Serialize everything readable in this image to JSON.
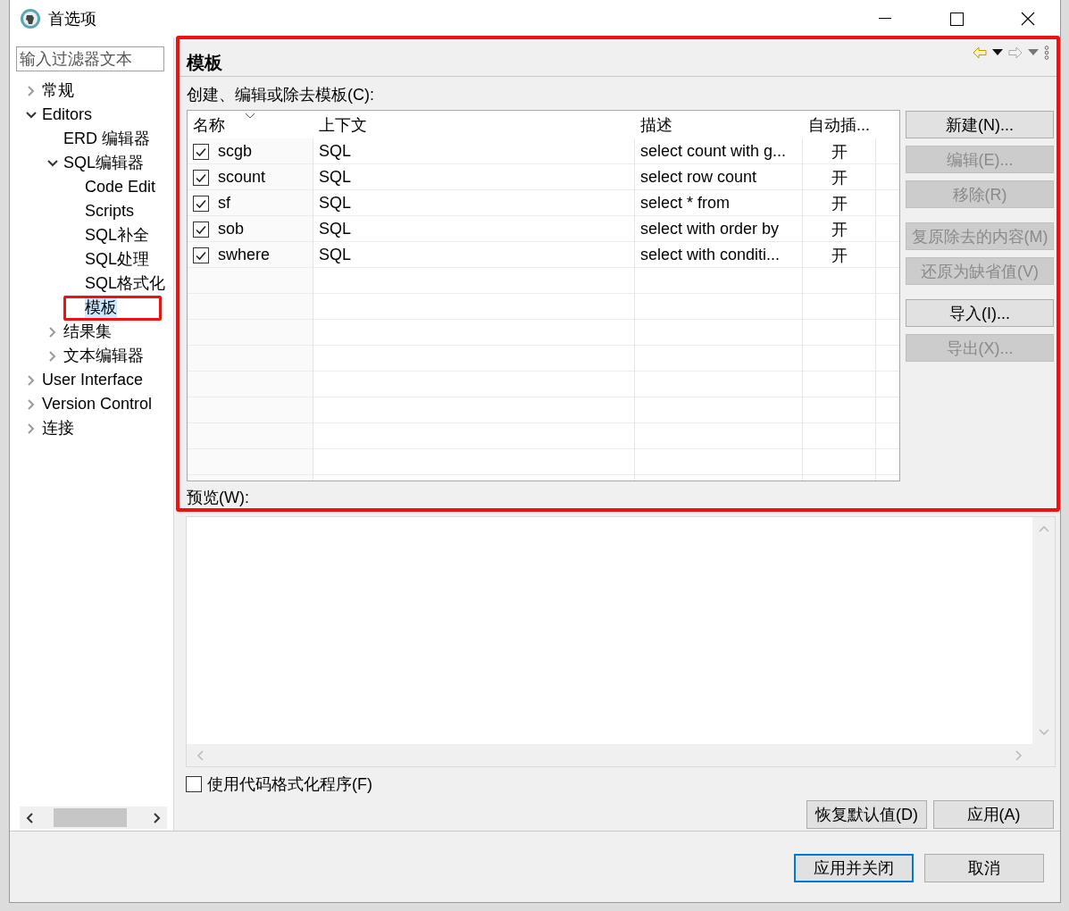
{
  "window": {
    "title": "首选项"
  },
  "filter": {
    "placeholder": "输入过滤器文本"
  },
  "tree": [
    {
      "label": "常规",
      "expanded": false,
      "selected": false
    },
    {
      "label": "Editors",
      "expanded": true,
      "selected": false,
      "children": [
        {
          "label": "ERD 编辑器",
          "selected": false
        },
        {
          "label": "SQL编辑器",
          "expanded": true,
          "selected": false,
          "children": [
            {
              "label": "Code Edit",
              "selected": false
            },
            {
              "label": "Scripts",
              "selected": false
            },
            {
              "label": "SQL补全",
              "selected": false
            },
            {
              "label": "SQL处理",
              "selected": false
            },
            {
              "label": "SQL格式化",
              "selected": false
            },
            {
              "label": "模板",
              "selected": true,
              "highlighted": true
            }
          ]
        },
        {
          "label": "结果集",
          "expanded": false,
          "selected": false
        },
        {
          "label": "文本编辑器",
          "expanded": false,
          "selected": false
        }
      ]
    },
    {
      "label": "User Interface",
      "expanded": false,
      "selected": false
    },
    {
      "label": "Version Control",
      "expanded": false,
      "selected": false
    },
    {
      "label": "连接",
      "expanded": false,
      "selected": false
    }
  ],
  "page": {
    "title": "模板",
    "highlighted": true,
    "nav": {
      "back_enabled": true,
      "forward_enabled": false
    },
    "table_label": "创建、编辑或除去模板(C):",
    "table": {
      "columns": [
        {
          "label": "名称",
          "sorted": true
        },
        {
          "label": "上下文",
          "sorted": false
        },
        {
          "label": "描述",
          "sorted": false
        },
        {
          "label": "自动插...",
          "sorted": false
        }
      ],
      "rows": [
        {
          "checked": true,
          "name": "scgb",
          "context": "SQL",
          "description": "select count with g...",
          "auto_insert": "开"
        },
        {
          "checked": true,
          "name": "scount",
          "context": "SQL",
          "description": "select row count",
          "auto_insert": "开"
        },
        {
          "checked": true,
          "name": "sf",
          "context": "SQL",
          "description": "select * from",
          "auto_insert": "开"
        },
        {
          "checked": true,
          "name": "sob",
          "context": "SQL",
          "description": "select with order by",
          "auto_insert": "开"
        },
        {
          "checked": true,
          "name": "swhere",
          "context": "SQL",
          "description": "select with conditi...",
          "auto_insert": "开"
        }
      ]
    },
    "button_groups": [
      [
        {
          "label": "新建(N)...",
          "disabled": false
        },
        {
          "label": "编辑(E)...",
          "disabled": true
        },
        {
          "label": "移除(R)",
          "disabled": true
        }
      ],
      [
        {
          "label": "复原除去的内容(M)",
          "disabled": true
        },
        {
          "label": "还原为缺省值(V)",
          "disabled": true
        }
      ],
      [
        {
          "label": "导入(I)...",
          "disabled": false
        },
        {
          "label": "导出(X)...",
          "disabled": true
        }
      ]
    ],
    "preview_label": "预览(W):",
    "formatter": {
      "label": "使用代码格式化程序(F)",
      "checked": false
    },
    "page_buttons": [
      "恢复默认值(D)",
      "应用(A)"
    ]
  },
  "dialog_buttons": [
    {
      "label": "应用并关闭",
      "default": true
    },
    {
      "label": "取消",
      "default": false
    }
  ]
}
